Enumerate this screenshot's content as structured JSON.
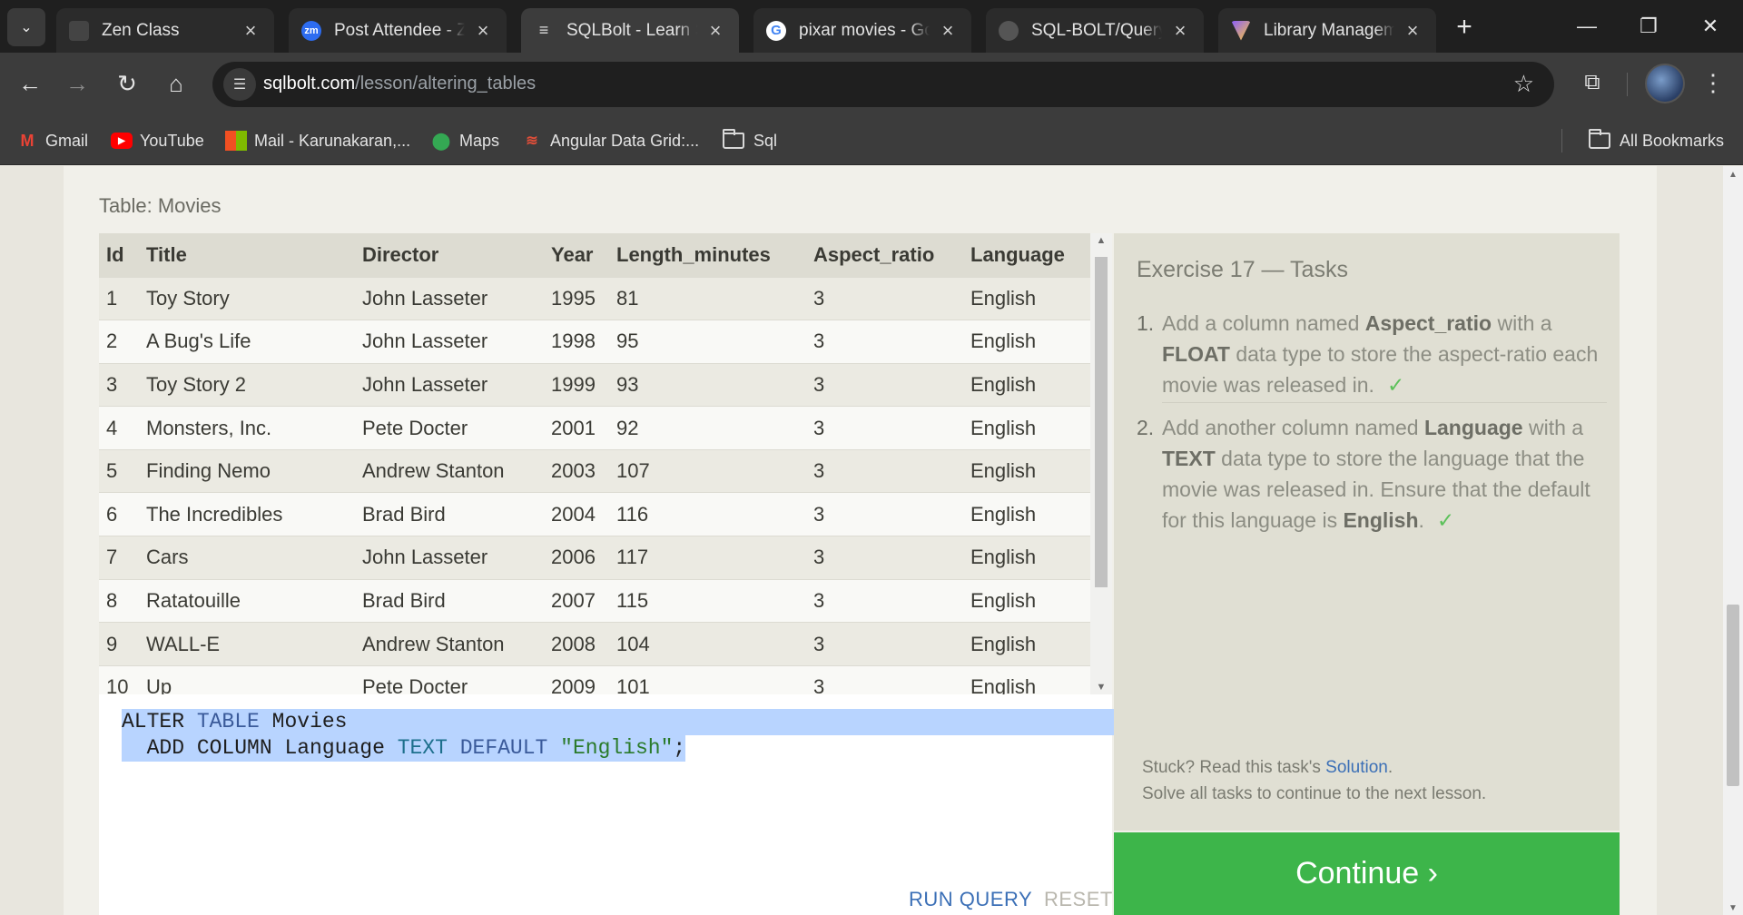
{
  "browser": {
    "tabs": [
      {
        "title": "Zen Class",
        "icon": "zen-class-favicon"
      },
      {
        "title": "Post Attendee - Zoom",
        "icon": "zoom-favicon"
      },
      {
        "title": "SQLBolt - Learn SQL",
        "icon": "sqlbolt-favicon"
      },
      {
        "title": "pixar movies - Google",
        "icon": "google-favicon"
      },
      {
        "title": "SQL-BOLT/Query-Alter",
        "icon": "github-favicon"
      },
      {
        "title": "Library Management",
        "icon": "vite-favicon"
      }
    ],
    "url_host": "sqlbolt.com",
    "url_path": "/lesson/altering_tables",
    "bookmarks": [
      {
        "label": "Gmail"
      },
      {
        "label": "YouTube"
      },
      {
        "label": "Mail - Karunakaran,..."
      },
      {
        "label": "Maps"
      },
      {
        "label": "Angular Data Grid:..."
      },
      {
        "label": "Sql"
      }
    ],
    "all_bookmarks": "All Bookmarks"
  },
  "lesson": {
    "table_caption": "Table: Movies",
    "columns": [
      "Id",
      "Title",
      "Director",
      "Year",
      "Length_minutes",
      "Aspect_ratio",
      "Language"
    ],
    "rows": [
      [
        "1",
        "Toy Story",
        "John Lasseter",
        "1995",
        "81",
        "3",
        "English"
      ],
      [
        "2",
        "A Bug's Life",
        "John Lasseter",
        "1998",
        "95",
        "3",
        "English"
      ],
      [
        "3",
        "Toy Story 2",
        "John Lasseter",
        "1999",
        "93",
        "3",
        "English"
      ],
      [
        "4",
        "Monsters, Inc.",
        "Pete Docter",
        "2001",
        "92",
        "3",
        "English"
      ],
      [
        "5",
        "Finding Nemo",
        "Andrew Stanton",
        "2003",
        "107",
        "3",
        "English"
      ],
      [
        "6",
        "The Incredibles",
        "Brad Bird",
        "2004",
        "116",
        "3",
        "English"
      ],
      [
        "7",
        "Cars",
        "John Lasseter",
        "2006",
        "117",
        "3",
        "English"
      ],
      [
        "8",
        "Ratatouille",
        "Brad Bird",
        "2007",
        "115",
        "3",
        "English"
      ],
      [
        "9",
        "WALL-E",
        "Andrew Stanton",
        "2008",
        "104",
        "3",
        "English"
      ],
      [
        "10",
        "Up",
        "Pete Docter",
        "2009",
        "101",
        "3",
        "English"
      ]
    ],
    "editor": {
      "line1": {
        "kw1": "ALTER",
        "kw2": "TABLE",
        "rest": "Movies"
      },
      "line2": {
        "indent": "  ",
        "kw1": "ADD COLUMN",
        "name": "Language",
        "type": "TEXT",
        "kw3": "DEFAULT",
        "str": "\"English\"",
        "end": ";"
      }
    },
    "run_query": "RUN QUERY",
    "reset": "RESET",
    "tasks_title": "Exercise 17 — Tasks",
    "tasks": [
      {
        "num": "1.",
        "parts": [
          "Add a column named ",
          "Aspect_ratio",
          " with a ",
          "FLOAT",
          " data type to store the aspect-ratio each movie was released in."
        ],
        "done": "✓"
      },
      {
        "num": "2.",
        "parts": [
          "Add another column named ",
          "Language",
          " with a ",
          "TEXT",
          " data type to store the language that the movie was released in. Ensure that the default for this language is ",
          "English",
          "."
        ],
        "done": "✓"
      }
    ],
    "stuck_prefix": "Stuck? Read this task's ",
    "solution_link": "Solution",
    "stuck_suffix": ".",
    "solve_all": "Solve all tasks to continue to the next lesson.",
    "continue": "Continue ›"
  }
}
